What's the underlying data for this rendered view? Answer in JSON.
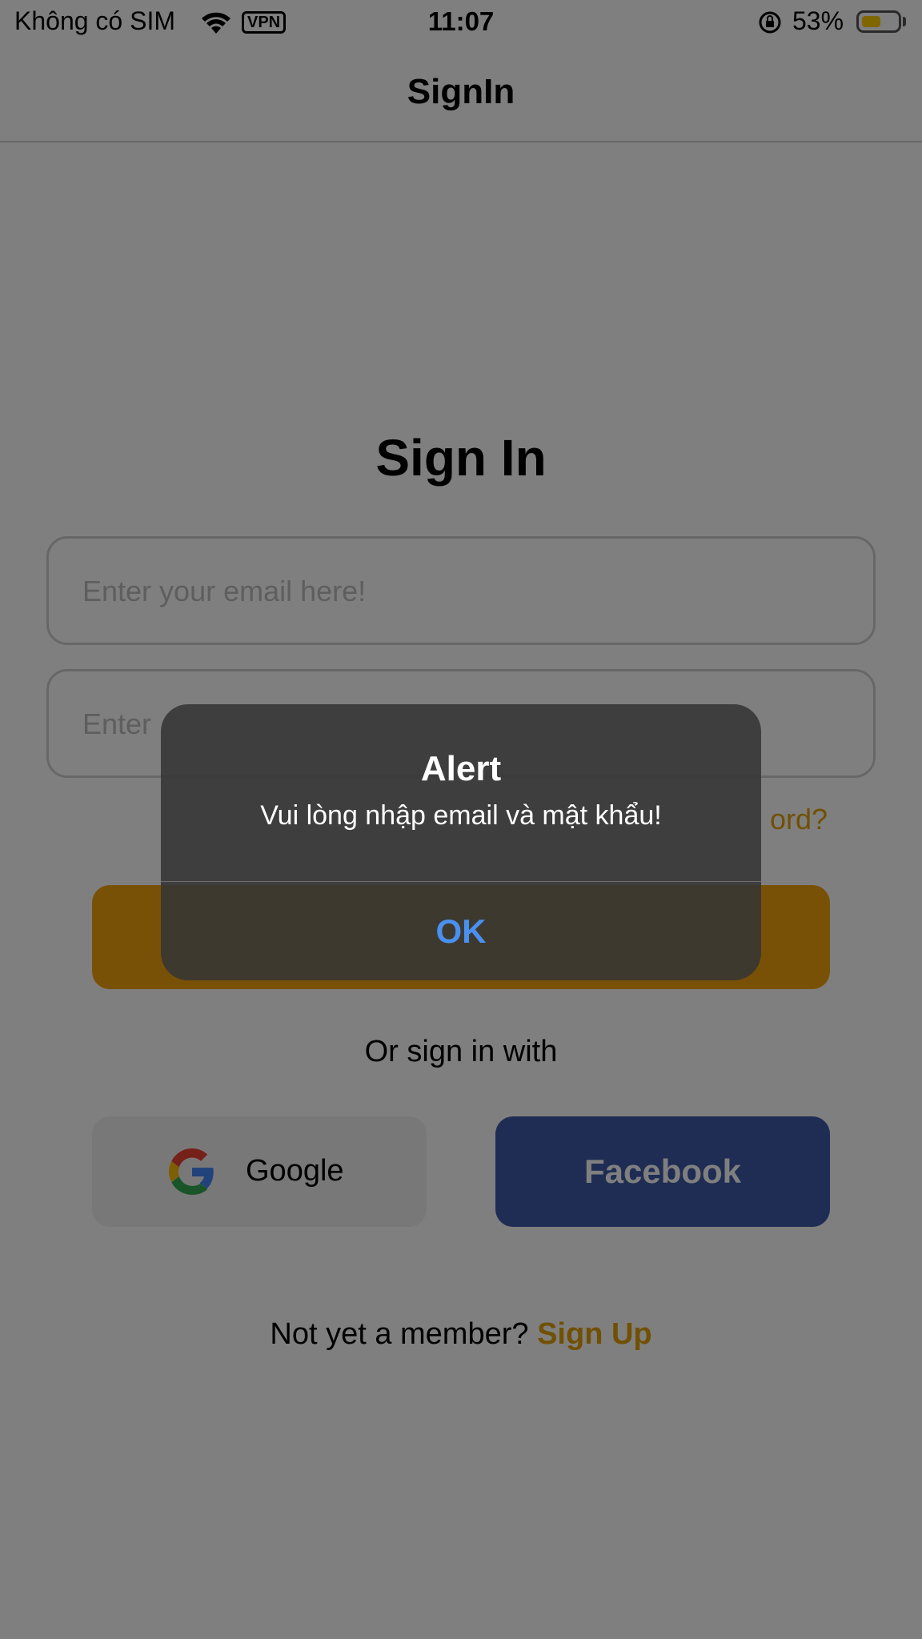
{
  "status_bar": {
    "carrier": "Không có SIM",
    "vpn": "VPN",
    "time": "11:07",
    "battery_percent": "53%",
    "battery_level": 0.53,
    "battery_color": "#ffcc00"
  },
  "nav": {
    "title": "SignIn"
  },
  "form": {
    "heading": "Sign In",
    "email_placeholder": "Enter your email here!",
    "password_placeholder_visible": "Enter",
    "forgot_password_visible": "ord?",
    "accent_color": "#f2a30c"
  },
  "social": {
    "or_text": "Or sign in with",
    "google_label": "Google",
    "facebook_label": "Facebook",
    "facebook_color": "#3f5aa8"
  },
  "footer": {
    "member_text": "Not yet a member?",
    "signup_label": "Sign Up"
  },
  "alert": {
    "title": "Alert",
    "message": "Vui lòng nhập email và mật khẩu!",
    "ok_label": "OK",
    "ok_color": "#4a90f0"
  }
}
